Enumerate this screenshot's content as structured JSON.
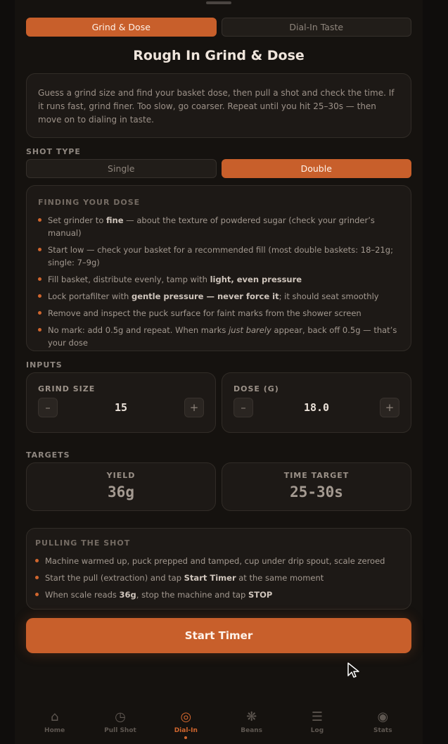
{
  "mode_tabs": [
    "Grind & Dose",
    "Dial-In Taste"
  ],
  "page_title": "Rough In Grind & Dose",
  "intro_text": "Guess a grind size and find your basket dose, then pull a shot and check the time. If it runs fast, grind finer. Too slow, go coarser. Repeat until you hit 25–30s — then move on to dialing in taste.",
  "shot_type": {
    "label": "SHOT TYPE",
    "options": [
      "Single",
      "Double"
    ],
    "selected": "Double"
  },
  "finding_dose": {
    "title": "FINDING YOUR DOSE",
    "items": [
      [
        "Set grinder to ",
        {
          "b": "fine"
        },
        " — about the texture of powdered sugar (check your grinder’s manual)"
      ],
      [
        "Start low — check your basket for a recommended fill (most double baskets: 18–21g; single: 7–9g)"
      ],
      [
        "Fill basket, distribute evenly, tamp with ",
        {
          "b": "light, even pressure"
        }
      ],
      [
        "Lock portafilter with ",
        {
          "b": "gentle pressure — never force it"
        },
        "; it should seat smoothly"
      ],
      [
        "Remove and inspect the puck surface for faint marks from the shower screen"
      ],
      [
        "No mark: add 0.5g and repeat. When marks ",
        {
          "i": "just barely"
        },
        " appear, back off 0.5g — that’s your dose"
      ]
    ]
  },
  "inputs": {
    "label": "INPUTS",
    "grind": {
      "label": "GRIND SIZE",
      "value": "15",
      "minus": "–",
      "plus": "+"
    },
    "dose": {
      "label": "DOSE (G)",
      "value": "18.0",
      "minus": "–",
      "plus": "+"
    }
  },
  "targets": {
    "label": "TARGETS",
    "yield": {
      "label": "YIELD",
      "value": "36g"
    },
    "time": {
      "label": "TIME TARGET",
      "value": "25-30s"
    }
  },
  "pulling": {
    "title": "PULLING THE SHOT",
    "items": [
      [
        "Machine warmed up, puck prepped and tamped, cup under drip spout, scale zeroed"
      ],
      [
        "Start the pull (extraction) and tap ",
        {
          "b": "Start Timer"
        },
        " at the same moment"
      ],
      [
        "When scale reads ",
        {
          "b": "36g"
        },
        ", stop the machine and tap ",
        {
          "b": "STOP"
        }
      ]
    ]
  },
  "start_button": "Start Timer",
  "nav": [
    {
      "label": "Home",
      "icon": "home-icon",
      "glyph": "⌂"
    },
    {
      "label": "Pull Shot",
      "icon": "clock-icon",
      "glyph": "◷"
    },
    {
      "label": "Dial-In",
      "icon": "target-icon",
      "glyph": "◎",
      "active": true
    },
    {
      "label": "Beans",
      "icon": "bean-icon",
      "glyph": "❋"
    },
    {
      "label": "Log",
      "icon": "list-icon",
      "glyph": "☰"
    },
    {
      "label": "Stats",
      "icon": "stats-icon",
      "glyph": "◉"
    }
  ],
  "colors": {
    "accent": "#c85f2b",
    "background": "#15120f",
    "card": "#1d1916"
  }
}
